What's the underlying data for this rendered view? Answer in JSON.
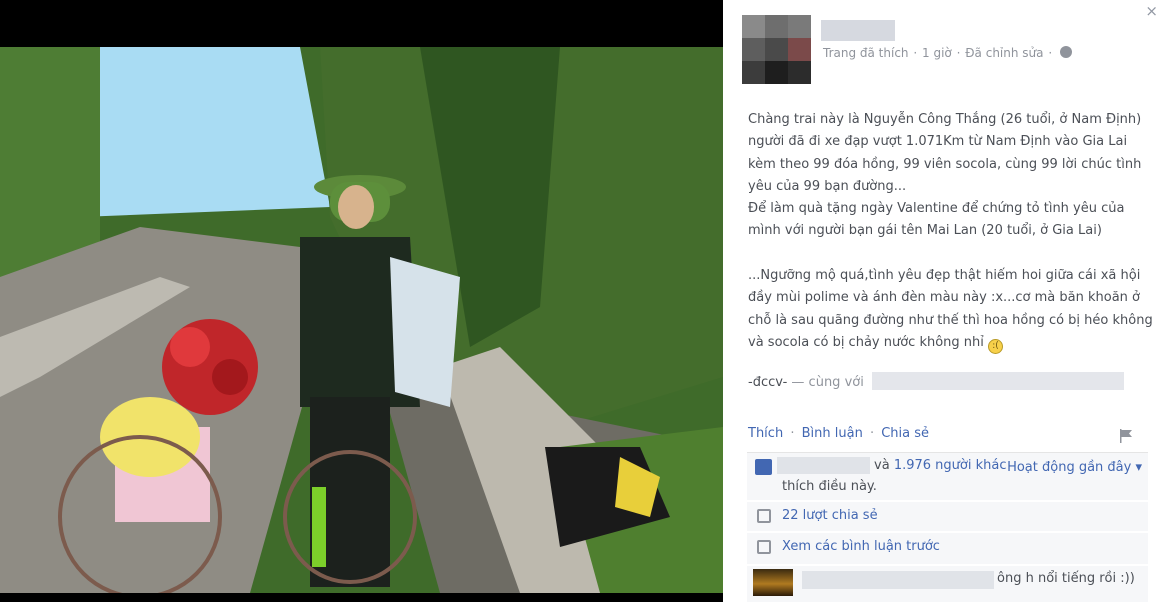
{
  "close_glyph": "×",
  "post": {
    "meta": {
      "liked_page": "Trang đã thích",
      "dot1": "·",
      "time": "1 giờ",
      "dot2": "·",
      "edited": "Đã chỉnh sửa",
      "dot3": "·"
    },
    "paragraphs": [
      "Chàng trai này là Nguyễn Công Thắng (26 tuổi, ở Nam Định) người đã đi xe đạp vượt 1.071Km từ Nam Định vào Gia Lai kèm theo 99 đóa hồng, 99 viên socola, cùng 99 lời chúc tình yêu của 99 bạn đường...",
      "Để làm quà tặng ngày Valentine để chứng tỏ tình yêu của mình với người bạn gái tên Mai Lan (20 tuổi, ở Gia Lai)",
      "...Ngưỡng mộ quá,tình yêu đẹp thật hiếm hoi giữa cái xã hội đầy mùi polime và ánh đèn màu này :x...cơ mà băn khoăn ở chỗ là sau quãng đường như thế thì hoa hồng có bị héo không và socola có bị chảy nước không nhỉ"
    ],
    "emoji": ":(",
    "signature": "-đccv-",
    "with_label": "— cùng với"
  },
  "actions": {
    "like": "Thích",
    "comment": "Bình luận",
    "share": "Chia sẻ",
    "sep": "·"
  },
  "likes": {
    "and": "và",
    "others": "1.976 người khác",
    "suffix": "thích điều này.",
    "activity": "Hoạt động gần đây ▾"
  },
  "shares": "22 lượt chia sẻ",
  "previous_comments": "Xem các bình luận trước",
  "comment_snippet": "ông h nổi tiếng rồi :))",
  "colors": {
    "link": "#4267b2",
    "text": "#4b4f56",
    "muted": "#90949c",
    "box_bg": "#f6f7f9"
  }
}
